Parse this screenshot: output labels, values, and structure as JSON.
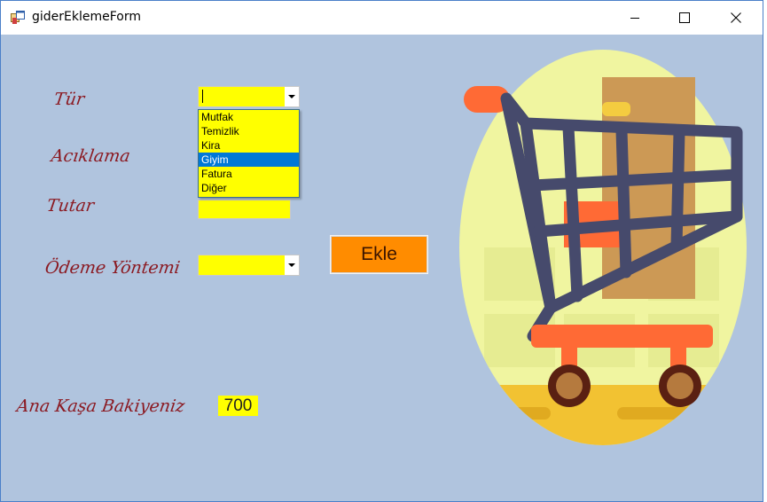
{
  "window": {
    "title": "giderEklemeForm"
  },
  "titlebar": {
    "minimize_icon": "minimize-icon",
    "maximize_icon": "maximize-icon",
    "close_icon": "close-icon"
  },
  "form": {
    "tur_label": "Tür",
    "aciklama_label": "Acıklama",
    "tutar_label": "Tutar",
    "odeme_label": "Ödeme Yöntemi",
    "balance_label": "Ana Kaşa Bakiyeniz",
    "balance_value": "700",
    "ekle_button": "Ekle",
    "tur_options": [
      "Mutfak",
      "Temizlik",
      "Kira",
      "Giyim",
      "Fatura",
      "Diğer"
    ],
    "tur_highlighted": "Giyim"
  },
  "colors": {
    "background": "#b0c4de",
    "field": "#ffff00",
    "label": "#8b1a22",
    "button": "#ff8c00",
    "highlight": "#0078d7"
  },
  "illustration": "shopping-cart-illustration"
}
